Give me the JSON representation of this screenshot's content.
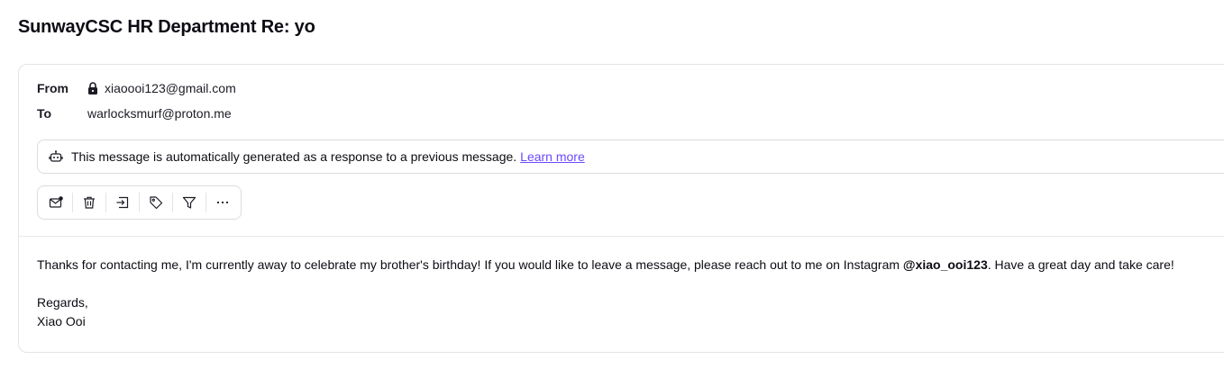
{
  "subject": "SunwayCSC HR Department Re: yo",
  "header": {
    "from_label": "From",
    "from_value": "xiaoooi123@gmail.com",
    "to_label": "To",
    "to_value": "warlocksmurf@proton.me"
  },
  "notice": {
    "text": "This message is automatically generated as a response to a previous message.",
    "link": "Learn more",
    "icon": "robot-icon"
  },
  "toolbar": {
    "buttons": [
      {
        "name": "mark-unread-button",
        "icon": "envelope-dot-icon"
      },
      {
        "name": "trash-button",
        "icon": "trash-icon"
      },
      {
        "name": "move-to-button",
        "icon": "move-folder-icon"
      },
      {
        "name": "label-button",
        "icon": "tag-icon"
      },
      {
        "name": "filter-button",
        "icon": "filter-icon"
      },
      {
        "name": "more-button",
        "icon": "more-dots-icon"
      }
    ]
  },
  "body": {
    "line1_before": "Thanks for contacting me, I'm currently away to celebrate my brother's birthday! If you would like to leave a message, please reach out to me on Instagram ",
    "line1_bold": "@xiao_ooi123",
    "line1_after": ". Have a great day and take care!",
    "regards": "Regards,",
    "signature": "Xiao Ooi"
  },
  "colors": {
    "accent_link": "#6d4aff",
    "border": "#dcdce0",
    "text": "#0c0c14"
  }
}
